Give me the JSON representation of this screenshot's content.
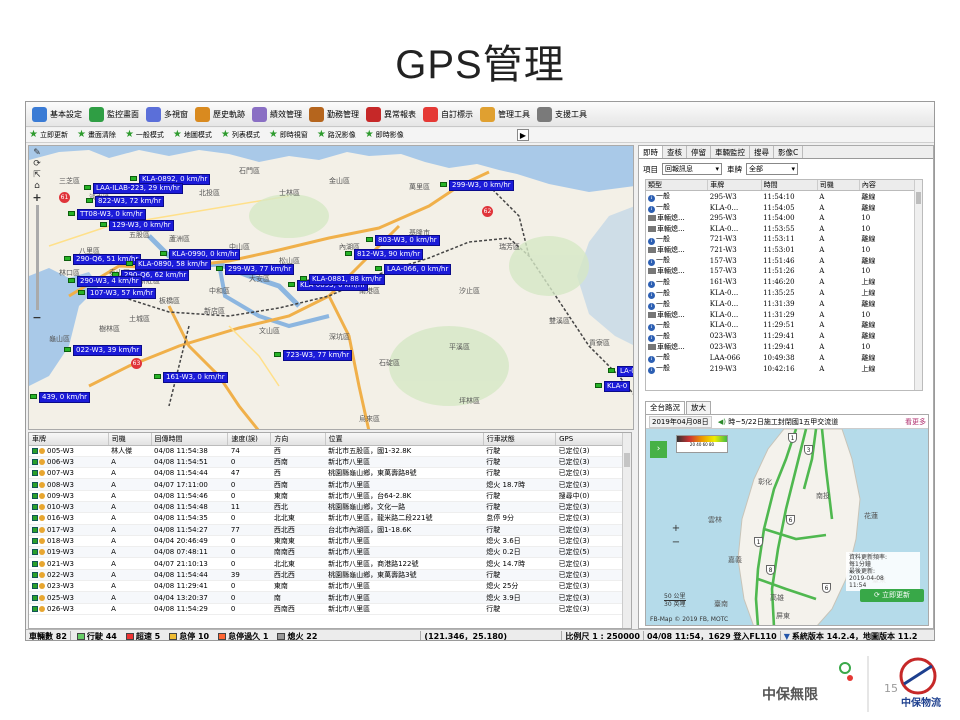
{
  "slide": {
    "title": "GPS管理",
    "page_number": "15",
    "brand_left": "中保無限",
    "brand_right": "中保物流"
  },
  "toolbar": [
    {
      "label": "基本設定",
      "icon": "people-icon",
      "color": "#3a7bd5"
    },
    {
      "label": "監控畫面",
      "icon": "monitor-icon",
      "color": "#2f9e44"
    },
    {
      "label": "多視窗",
      "icon": "windows-icon",
      "color": "#5b6fd9"
    },
    {
      "label": "歷史軌跡",
      "icon": "truck-icon",
      "color": "#d98a1f"
    },
    {
      "label": "績效管理",
      "icon": "chart-icon",
      "color": "#8a6fc4"
    },
    {
      "label": "勤務管理",
      "icon": "briefcase-icon",
      "color": "#b5651d"
    },
    {
      "label": "異常報表",
      "icon": "report-icon",
      "color": "#c62828"
    },
    {
      "label": "自訂標示",
      "icon": "heart-icon",
      "color": "#e53935"
    },
    {
      "label": "管理工具",
      "icon": "box-icon",
      "color": "#e0a030"
    },
    {
      "label": "支援工具",
      "icon": "link-icon",
      "color": "#7a7a7a"
    }
  ],
  "toolbar2": [
    "立即更新",
    "畫面清除",
    "一般模式",
    "地圖模式",
    "列表模式",
    "即時視窗",
    "路況影像",
    "即時影像"
  ],
  "map": {
    "districts": [
      "北投區",
      "士林區",
      "淡水區",
      "三芝區",
      "石門區",
      "金山區",
      "萬里區",
      "基隆市",
      "瑞芳區",
      "中山區",
      "松山區",
      "大安區",
      "信義區",
      "內湖區",
      "南港區",
      "汐止區",
      "新店區",
      "文山區",
      "深坑區",
      "石碇區",
      "平溪區",
      "雙溪區",
      "貢寮區",
      "三重區",
      "新莊區",
      "板橋區",
      "中和區",
      "永和區",
      "土城區",
      "樹林區",
      "蘆洲區",
      "五股區",
      "八里區",
      "泰山區",
      "林口區",
      "龜山區",
      "坪林區",
      "烏來區"
    ],
    "pois": [
      "61",
      "62",
      "63"
    ],
    "vehicles": [
      "KLA-0892, 0 km/hr",
      "LAA-ILAB-223, 29 km/hr",
      "822-W3, 72 km/hr",
      "TT08-W3, 0 km/hr",
      "129-W3, 0 km/hr",
      "290-Q6, 51 km/hr",
      "KLA-0890, 58 km/hr",
      "290-Q6, 62 km/hr",
      "KLA-0990, 0 km/hr",
      "290-W3, 4 km/hr",
      "107-W3, 57 km/hr",
      "299-W3, 77 km/hr",
      "KLA-0893, 0 km/hr",
      "803-W3, 0 km/hr",
      "812-W3, 90 km/hr",
      "LAA-066, 0 km/hr",
      "KLA-0881, 88 km/hr",
      "299-W3, 0 km/hr",
      "022-W3, 39 km/hr",
      "723-W3, 77 km/hr",
      "161-W3, 0 km/hr",
      "439, 0 km/hr",
      "KLA-0",
      "LA-0"
    ]
  },
  "grid": {
    "columns": [
      "車牌",
      "司機",
      "回傳時間",
      "速度(誤)",
      "方向",
      "位置",
      "行車狀態",
      "GPS"
    ],
    "rows": [
      [
        "005-W3",
        "林人傑",
        "04/08 11:54:38",
        "74",
        "西",
        "新北市五股區，國1-32.8K",
        "行駛",
        "已定位(3)"
      ],
      [
        "006-W3",
        "A",
        "04/08 11:54:51",
        "0",
        "西南",
        "新北市八里區",
        "行駛",
        "已定位(3)"
      ],
      [
        "007-W3",
        "A",
        "04/08 11:54:44",
        "47",
        "西",
        "桃園縣龜山鄉，東萬壽路8號",
        "行駛",
        "已定位(3)"
      ],
      [
        "008-W3",
        "A",
        "04/07 17:11:00",
        "0",
        "西南",
        "新北市八里區",
        "熄火 18.7時",
        "已定位(3)"
      ],
      [
        "009-W3",
        "A",
        "04/08 11:54:46",
        "0",
        "東南",
        "新北市八里區，台64-2.8K",
        "行駛",
        "搜尋中(0)"
      ],
      [
        "010-W3",
        "A",
        "04/08 11:54:48",
        "11",
        "西北",
        "桃園縣龜山鄉，文化一路",
        "行駛",
        "已定位(3)"
      ],
      [
        "016-W3",
        "A",
        "04/08 11:54:35",
        "0",
        "北北東",
        "新北市八里區，龍米路二段221號",
        "怠停 9分",
        "已定位(3)"
      ],
      [
        "017-W3",
        "A",
        "04/08 11:54:27",
        "77",
        "西北西",
        "台北市內湖區，國1-18.6K",
        "行駛",
        "已定位(3)"
      ],
      [
        "018-W3",
        "A",
        "04/04 20:46:49",
        "0",
        "東南東",
        "新北市八里區",
        "熄火 3.6日",
        "已定位(3)"
      ],
      [
        "019-W3",
        "A",
        "04/08 07:48:11",
        "0",
        "南南西",
        "新北市八里區",
        "熄火 0.2日",
        "已定位(5)"
      ],
      [
        "021-W3",
        "A",
        "04/07 21:10:13",
        "0",
        "北北東",
        "新北市八里區，商港路122號",
        "熄火 14.7時",
        "已定位(3)"
      ],
      [
        "022-W3",
        "A",
        "04/08 11:54:44",
        "39",
        "西北西",
        "桃園縣龜山鄉，東萬壽路3號",
        "行駛",
        "已定位(3)"
      ],
      [
        "023-W3",
        "A",
        "04/08 11:29:41",
        "0",
        "東南",
        "新北市八里區",
        "熄火 25分",
        "已定位(3)"
      ],
      [
        "025-W3",
        "A",
        "04/04 13:20:37",
        "0",
        "南",
        "新北市八里區",
        "熄火 3.9日",
        "已定位(3)"
      ],
      [
        "026-W3",
        "A",
        "04/08 11:54:29",
        "0",
        "西南西",
        "新北市八里區",
        "行駛",
        "已定位(3)"
      ]
    ]
  },
  "right": {
    "tabs": [
      "即時",
      "查核",
      "停留",
      "車輛監控",
      "搜尋",
      "影像C"
    ],
    "filter": {
      "item_label": "項目",
      "item_value": "回報訊息",
      "plate_label": "車牌",
      "plate_value": "全部"
    },
    "events": {
      "columns": [
        "類型",
        "車牌",
        "時間",
        "司機",
        "內容"
      ],
      "rows": [
        [
          "一般",
          "295-W3",
          "11:54:10",
          "A",
          "離線"
        ],
        [
          "一般",
          "KLA-0...",
          "11:54:05",
          "A",
          "離線"
        ],
        [
          "車輛熄...",
          "295-W3",
          "11:54:00",
          "A",
          "10"
        ],
        [
          "車輛熄...",
          "KLA-0...",
          "11:53:55",
          "A",
          "10"
        ],
        [
          "一般",
          "721-W3",
          "11:53:11",
          "A",
          "離線"
        ],
        [
          "車輛熄...",
          "721-W3",
          "11:53:01",
          "A",
          "10"
        ],
        [
          "一般",
          "157-W3",
          "11:51:46",
          "A",
          "離線"
        ],
        [
          "車輛熄...",
          "157-W3",
          "11:51:26",
          "A",
          "10"
        ],
        [
          "一般",
          "161-W3",
          "11:46:20",
          "A",
          "上線"
        ],
        [
          "一般",
          "KLA-0...",
          "11:35:25",
          "A",
          "上線"
        ],
        [
          "一般",
          "KLA-0...",
          "11:31:39",
          "A",
          "離線"
        ],
        [
          "車輛熄...",
          "KLA-0...",
          "11:31:29",
          "A",
          "10"
        ],
        [
          "一般",
          "KLA-0...",
          "11:29:51",
          "A",
          "離線"
        ],
        [
          "一般",
          "023-W3",
          "11:29:41",
          "A",
          "離線"
        ],
        [
          "車輛熄...",
          "023-W3",
          "11:29:41",
          "A",
          "10"
        ],
        [
          "一般",
          "LAA-066",
          "10:49:38",
          "A",
          "離線"
        ],
        [
          "一般",
          "219-W3",
          "10:42:16",
          "A",
          "上線"
        ]
      ]
    },
    "tabs2": [
      "全台路況",
      "放大"
    ],
    "traffic": {
      "date": "2019年04月08日",
      "announce": "時~5/22日施工封閉國1五甲交流道",
      "more": "看更多",
      "places": [
        "彰化",
        "南投",
        "雲林",
        "嘉義",
        "臺南",
        "高雄",
        "屏東",
        "臺東",
        "花蓮"
      ],
      "highway_shields": [
        "1",
        "3",
        "6",
        "1",
        "8",
        "6"
      ],
      "update_text": [
        "資料更新頻率:",
        "每1分鐘",
        "最後更新:",
        "2019-04-08",
        "11:54"
      ],
      "update_button": "立即更新",
      "scale": [
        "50 公里",
        "30 英哩"
      ],
      "copyright": "FB-Map © 2019 FB, MOTC",
      "legend": "20 40 60 80",
      "accent": "#3aa94a"
    }
  },
  "status": {
    "total": "車輛數 82",
    "moving": "行駛 44",
    "speeding": "超速 5",
    "idle": "怠停 10",
    "idle_long": "怠停過久 1",
    "off": "熄火 22",
    "coords": "(121.346，25.180)",
    "scale": "比例尺 1 : 250000",
    "login": "04/08 11:54，1629 登入FL110",
    "version": "系統版本 14.2.4，地圖版本 11.2"
  }
}
